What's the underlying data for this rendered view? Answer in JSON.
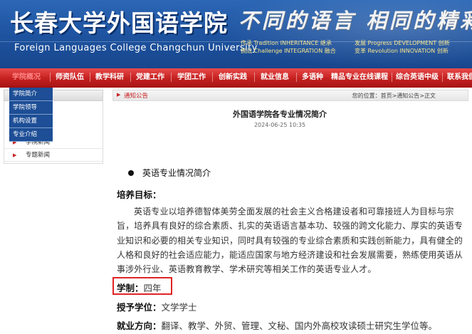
{
  "banner": {
    "title_cn": "长春大学外国语学院",
    "title_en": "Foreign Languages College Changchun University",
    "slogan": "不同的语言 相同的精彩",
    "values": [
      "传承 Tradition INHERITANCE 继承",
      "发展 Progress DEVELOPMENT 创新",
      "挑战 Challenge INTEGRATION 融合",
      "变革 Revolution INNOVATION 创新"
    ]
  },
  "nav": {
    "items": [
      "学院概况",
      "师资队伍",
      "教学科研",
      "党建工作",
      "学团工作",
      "创新实践",
      "就业信息",
      "多语种",
      "精品专业在线课程",
      "综合英语中级",
      "联系我们"
    ],
    "active_index": 0
  },
  "dropdown": {
    "items": [
      "学院简介",
      "学院领导",
      "机构设置",
      "专业介绍"
    ]
  },
  "sidebar": {
    "items": [
      "学院新闻",
      "专题新闻"
    ]
  },
  "crumb": {
    "title": "通知公告",
    "prefix": "您的位置：",
    "home": "首页",
    "sep1": ">",
    "category": "通知公告",
    "sep2": ">",
    "current": "正文"
  },
  "article": {
    "title": "外国语学院各专业情况简介",
    "date": "2024-06-25 10:35",
    "section_heading": "英语专业情况简介",
    "goal_heading": "培养目标：",
    "goal_paragraph": "英语专业以培养德智体美劳全面发展的社会主义合格建设者和可靠接班人为目标与宗旨，培养具有良好的综合素质、扎实的英语语言基本功、较强的跨文化能力、厚实的英语专业知识和必要的相关专业知识，同时具有较强的专业综合素质和实践创新能力，具有健全的人格和良好的社会适应能力，能适应国家与地方经济建设和社会发展需要，熟练使用英语从事涉外行业、英语教育教学、学术研究等相关工作的英语专业人才。",
    "duration_label": "学制：",
    "duration_value": "四年",
    "degree_label": "授予学位：",
    "degree_value": "文学学士",
    "career_label": "就业方向：",
    "career_value": "翻译、教学、外贸、管理、文秘、国内外高校攻读硕士研究生学位等。"
  },
  "colors": {
    "banner_blue": "#1f55a2",
    "nav_red": "#c62121",
    "dropdown_blue": "#1d4e96",
    "highlight_red": "#e02424"
  }
}
